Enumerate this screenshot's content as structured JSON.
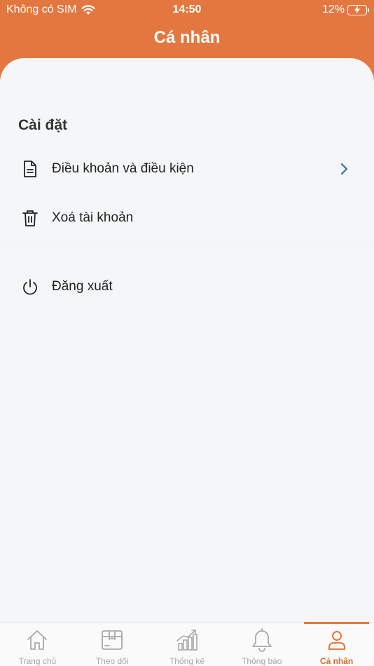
{
  "status_bar": {
    "carrier": "Không có SIM",
    "time": "14:50",
    "battery": "12%"
  },
  "header": {
    "title": "Cá nhân"
  },
  "settings": {
    "section_title": "Cài đặt",
    "items": [
      {
        "label": "Điều khoản và điều kiện",
        "icon": "document-icon"
      },
      {
        "label": "Xoá tài khoản",
        "icon": "trash-icon"
      }
    ]
  },
  "logout": {
    "label": "Đăng xuất",
    "icon": "power-icon"
  },
  "tabbar": {
    "tabs": [
      {
        "label": "Trang chủ",
        "icon": "home-icon"
      },
      {
        "label": "Theo dõi",
        "icon": "package-icon"
      },
      {
        "label": "Thống kê",
        "icon": "chart-icon"
      },
      {
        "label": "Thông báo",
        "icon": "bell-icon"
      },
      {
        "label": "Cá nhân",
        "icon": "user-icon",
        "active": true
      }
    ]
  },
  "colors": {
    "brand": "#E27840",
    "active_tab": "#D96E2F",
    "inactive_tab": "#A8A8A8",
    "chevron": "#3B6EA8"
  }
}
